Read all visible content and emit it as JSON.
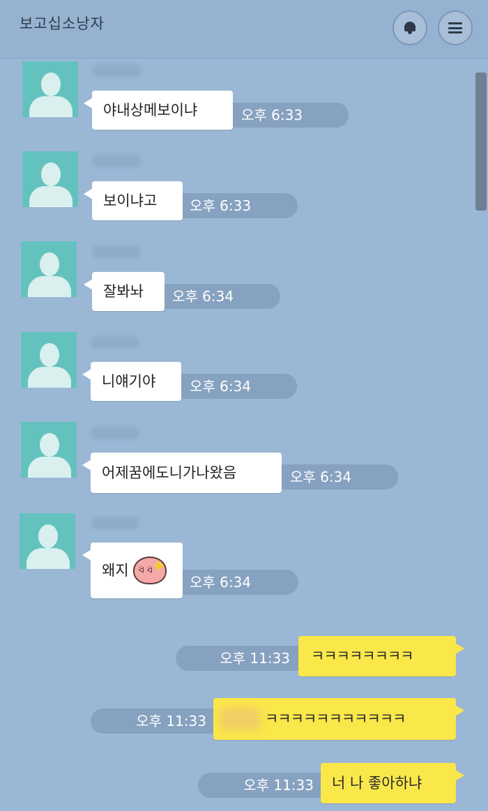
{
  "header": {
    "title": "보고십소낭자",
    "bell_icon": "bell-icon",
    "menu_icon": "menu-icon"
  },
  "messages": [
    {
      "side": "left",
      "text": "야내상메보이냐",
      "time": "오후 6:33"
    },
    {
      "side": "left",
      "text": "보이냐고",
      "time": "오후 6:33"
    },
    {
      "side": "left",
      "text": "잘봐놔",
      "time": "오후 6:34"
    },
    {
      "side": "left",
      "text": "니얘기야",
      "time": "오후 6:34"
    },
    {
      "side": "left",
      "text": "어제꿈에도니가나왔음",
      "time": "오후 6:34"
    },
    {
      "side": "left",
      "text": "왜지",
      "time": "오후 6:34",
      "emoticon": "peach-emoticon"
    },
    {
      "side": "right",
      "text": "ㅋㅋㅋㅋㅋㅋㅋㅋ",
      "time": "오후 11:33"
    },
    {
      "side": "right",
      "text": "ㅋㅋㅋㅋㅋㅋㅋㅋㅋㅋㅋ",
      "time": "오후 11:33"
    },
    {
      "side": "right",
      "text": "너 나 좋아하냐",
      "time": "오후 11:33"
    }
  ],
  "colors": {
    "background": "#9bb7d6",
    "my_bubble": "#fae74a",
    "their_bubble": "#ffffff",
    "avatar": "#64c2be"
  }
}
